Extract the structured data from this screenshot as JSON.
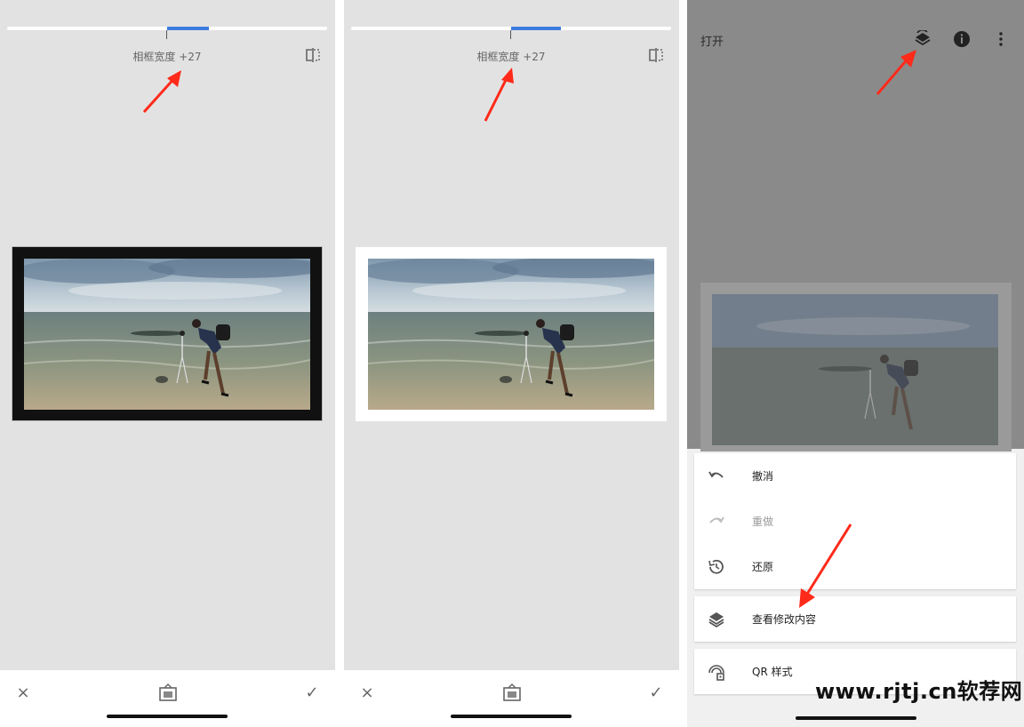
{
  "panels": [
    {
      "param_label": "相框宽度 +27",
      "slider_value": 27,
      "frame_color": "#111111",
      "cancel_icon": "×",
      "ok_icon": "✓"
    },
    {
      "param_label": "相框宽度 +27",
      "slider_value": 27,
      "frame_color": "#ffffff",
      "cancel_icon": "×",
      "ok_icon": "✓"
    }
  ],
  "panel3": {
    "title": "打开",
    "menu": [
      {
        "label": "撤消",
        "icon": "undo-icon",
        "enabled": true
      },
      {
        "label": "重做",
        "icon": "redo-icon",
        "enabled": false
      },
      {
        "label": "还原",
        "icon": "history-icon",
        "enabled": true
      },
      {
        "label": "查看修改内容",
        "icon": "layers-icon",
        "enabled": true
      },
      {
        "label": "QR 样式",
        "icon": "qr-style-icon",
        "enabled": true
      }
    ]
  },
  "watermark": "www.rjtj.cn软荐网",
  "colors": {
    "accent": "#3b7ddd",
    "annotation_arrow": "#ff2a1a"
  }
}
